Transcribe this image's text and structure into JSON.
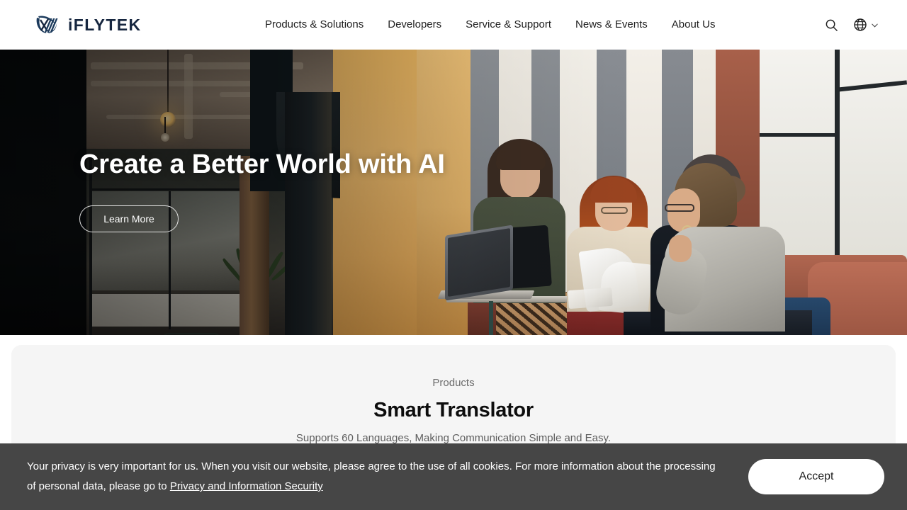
{
  "header": {
    "logo": {
      "text": "iFLYTEK",
      "icon": "iflytek-logo-mark",
      "color": "#16263f"
    },
    "nav": [
      {
        "label": "Products & Solutions"
      },
      {
        "label": "Developers"
      },
      {
        "label": "Service & Support"
      },
      {
        "label": "News & Events"
      },
      {
        "label": "About Us"
      }
    ],
    "actions": {
      "search_icon": "search-icon",
      "language_icon": "globe-icon",
      "language_chevron": "chevron-down-icon"
    }
  },
  "hero": {
    "title": "Create a Better World with AI",
    "button_label": "Learn More",
    "image_description": "Four colleagues in a modern office lounge having a discussion with laptops and documents"
  },
  "products": {
    "eyebrow": "Products",
    "title": "Smart Translator",
    "subtitle": "Supports 60 Languages, Making Communication Simple and Easy."
  },
  "cookie_banner": {
    "text_part1": "Your privacy is very important for us. When you visit our website, please agree to the use of all cookies. For more information about the processing of personal data, please go to ",
    "link_label": "Privacy and Information Security",
    "accept_label": "Accept",
    "background": "#464646"
  }
}
